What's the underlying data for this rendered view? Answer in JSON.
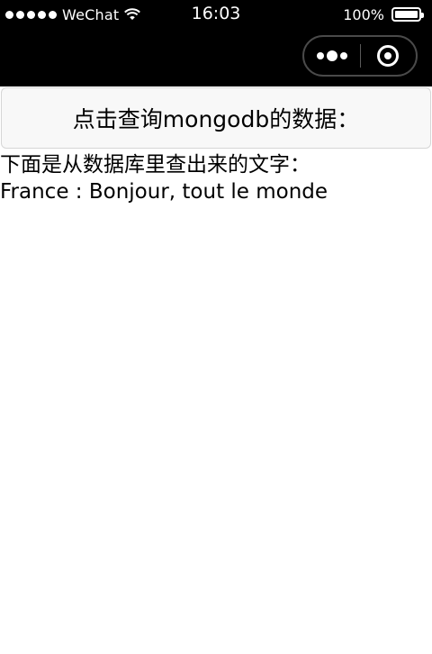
{
  "status_bar": {
    "carrier": "WeChat",
    "time": "16:03",
    "battery_percent": "100%",
    "signal_dots": 5,
    "icons": [
      "wifi-icon",
      "battery-icon"
    ]
  },
  "nav": {
    "capsule_icons": [
      "more-icon",
      "close-icon"
    ]
  },
  "main": {
    "query_button_label": "点击查询mongodb的数据：",
    "intro_text": "下面是从数据库里查出来的文字：",
    "result_text": "France : Bonjour, tout le monde"
  },
  "colors": {
    "topbar": "#000000",
    "button_bg": "#f8f8f8",
    "button_border": "#d6d6d6",
    "text": "#000000"
  }
}
